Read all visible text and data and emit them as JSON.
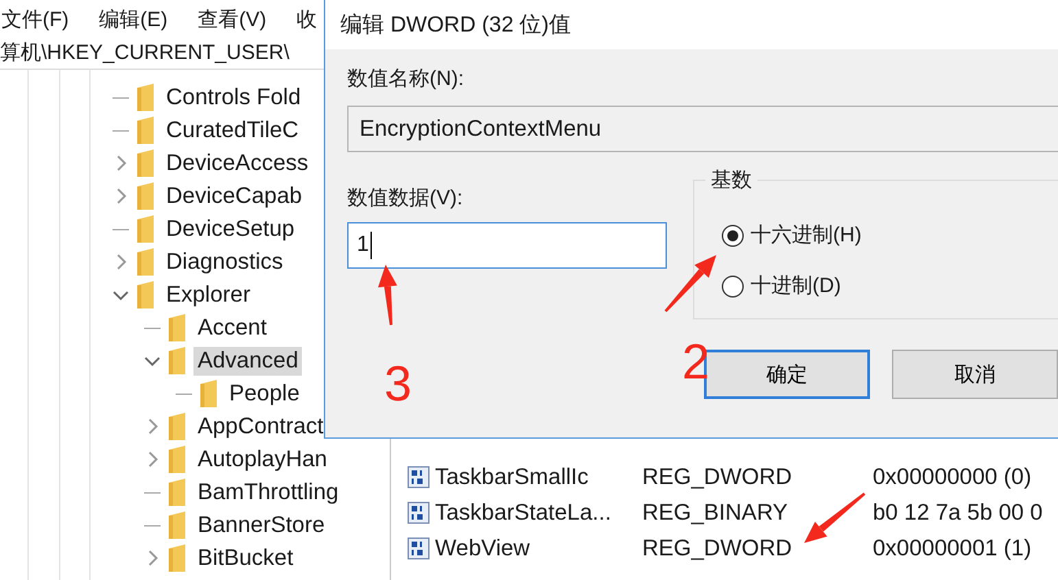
{
  "menu": [
    "文件(F)",
    "编辑(E)",
    "查看(V)",
    "收"
  ],
  "address": "算机\\HKEY_CURRENT_USER\\",
  "tree": [
    {
      "label": "Controls Fold",
      "expandable": false,
      "selected": false
    },
    {
      "label": "CuratedTileC",
      "expandable": false,
      "selected": false
    },
    {
      "label": "DeviceAccess",
      "expandable": true,
      "expanded": false,
      "selected": false
    },
    {
      "label": "DeviceCapab",
      "expandable": true,
      "expanded": false,
      "selected": false
    },
    {
      "label": "DeviceSetup",
      "expandable": false,
      "selected": false
    },
    {
      "label": "Diagnostics",
      "expandable": true,
      "expanded": false,
      "selected": false
    },
    {
      "label": "Explorer",
      "expandable": true,
      "expanded": true,
      "selected": false,
      "children": [
        {
          "label": "Accent",
          "expandable": false,
          "selected": false
        },
        {
          "label": "Advanced",
          "expandable": true,
          "expanded": true,
          "selected": true,
          "children": [
            {
              "label": "People",
              "expandable": false,
              "selected": false
            }
          ]
        },
        {
          "label": "AppContract",
          "expandable": true,
          "expanded": false,
          "selected": false
        },
        {
          "label": "AutoplayHan",
          "expandable": true,
          "expanded": false,
          "selected": false
        },
        {
          "label": "BamThrottling",
          "expandable": false,
          "selected": false
        },
        {
          "label": "BannerStore",
          "expandable": false,
          "selected": false
        },
        {
          "label": "BitBucket",
          "expandable": true,
          "expanded": false,
          "selected": false
        }
      ]
    }
  ],
  "values": [
    {
      "name": "TaskbarSmallIc",
      "type": "REG_DWORD",
      "data": "0x00000000 (0)"
    },
    {
      "name": "TaskbarStateLa...",
      "type": "REG_BINARY",
      "data": "b0 12 7a 5b 00 0"
    },
    {
      "name": "WebView",
      "type": "REG_DWORD",
      "data": "0x00000001 (1)"
    }
  ],
  "dialog": {
    "title": "编辑 DWORD (32 位)值",
    "name_label": "数值名称(N):",
    "name_value": "EncryptionContextMenu",
    "data_label": "数值数据(V):",
    "data_value": "1",
    "base_label": "基数",
    "bases": [
      {
        "label": "十六进制(H)",
        "selected": true
      },
      {
        "label": "十进制(D)",
        "selected": false
      }
    ],
    "buttons": [
      {
        "label": "确定",
        "default": true
      },
      {
        "label": "取消",
        "default": false
      }
    ]
  },
  "annotations": [
    {
      "kind": "arrow"
    },
    {
      "kind": "arrow"
    },
    {
      "kind": "arrow"
    },
    {
      "kind": "number",
      "text": "3"
    },
    {
      "kind": "number",
      "text": "2"
    }
  ]
}
